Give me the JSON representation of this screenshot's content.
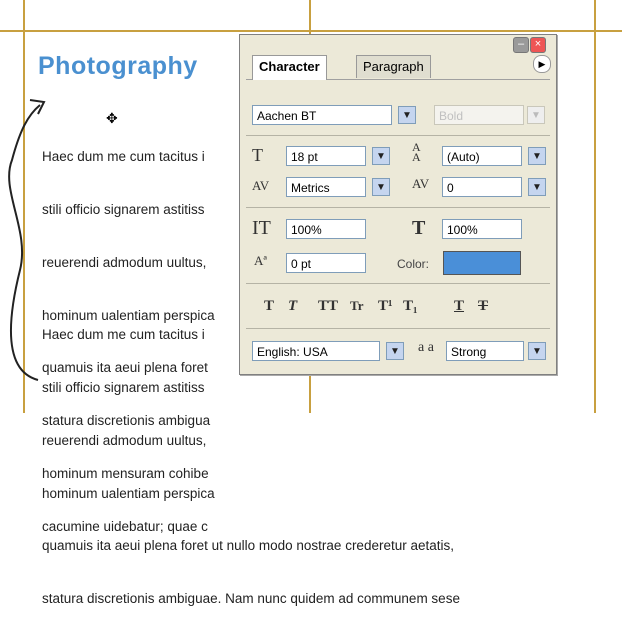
{
  "document": {
    "heading": "Photography",
    "paragraph1": [
      "Haec dum me cum tacitus i",
      "stili officio signarem astitiss",
      "reuerendi admodum uultus,",
      "hominum ualentiam perspica",
      "quamuis ita aeui plena foret",
      "statura discretionis ambigua",
      "hominum mensuram cohibe",
      "cacumine uidebatur; quae c"
    ],
    "paragraph2": [
      "Haec dum me cum tacitus i",
      "stili officio signarem astitiss",
      "reuerendi admodum uultus,",
      "hominum ualentiam perspica",
      "quamuis ita aeui plena foret ut nullo modo nostrae crederetur aetatis,",
      "statura discretionis ambiguae. Nam nunc quidem ad communem sese"
    ]
  },
  "palette": {
    "tabs": [
      "Character",
      "Paragraph"
    ],
    "font_family": "Aachen BT",
    "font_style": "Bold",
    "font_size": "18 pt",
    "leading": "(Auto)",
    "kerning": "Metrics",
    "tracking": "0",
    "vertical_scale": "100%",
    "horizontal_scale": "100%",
    "baseline_shift": "0 pt",
    "color_label": "Color:",
    "color_value": "#4a8fd8",
    "language": "English: USA",
    "antialias_icon_label": "a a",
    "antialias": "Strong",
    "style_buttons": [
      "T",
      "T",
      "TT",
      "Tr",
      "T¹",
      "T₁",
      "T",
      "T"
    ]
  }
}
